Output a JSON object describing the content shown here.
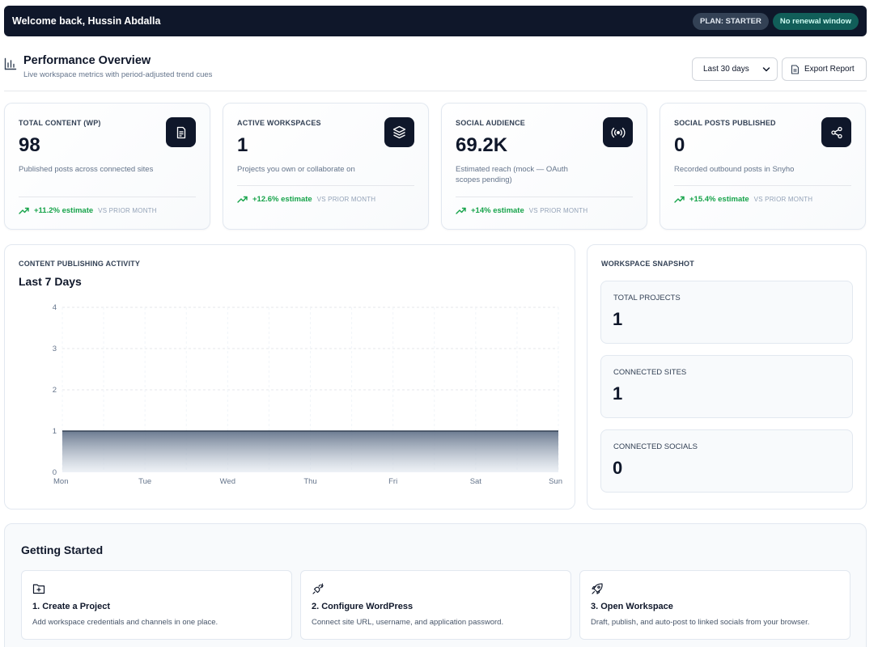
{
  "topbar": {
    "welcome": "Welcome back, Hussin Abdalla",
    "plan_badge": "PLAN: STARTER",
    "renewal_badge": "No renewal window"
  },
  "header": {
    "title": "Performance Overview",
    "subtitle": "Live workspace metrics with period-adjusted trend cues",
    "period_selected": "Last 30 days",
    "export_label": "Export Report"
  },
  "stats": [
    {
      "label": "TOTAL CONTENT (WP)",
      "value": "98",
      "desc": "Published posts across connected sites",
      "trend": "+11.2% estimate",
      "trend_note": "VS PRIOR MONTH",
      "icon": "document-icon"
    },
    {
      "label": "ACTIVE WORKSPACES",
      "value": "1",
      "desc": "Projects you own or collaborate on",
      "trend": "+12.6% estimate",
      "trend_note": "VS PRIOR MONTH",
      "icon": "layers-icon"
    },
    {
      "label": "SOCIAL AUDIENCE",
      "value": "69.2K",
      "desc": "Estimated reach (mock — OAuth scopes pending)",
      "trend": "+14% estimate",
      "trend_note": "VS PRIOR MONTH",
      "icon": "broadcast-icon"
    },
    {
      "label": "SOCIAL POSTS PUBLISHED",
      "value": "0",
      "desc": "Recorded outbound posts in Snyho",
      "trend": "+15.4% estimate",
      "trend_note": "VS PRIOR MONTH",
      "icon": "share-icon"
    }
  ],
  "chart": {
    "label": "CONTENT PUBLISHING ACTIVITY",
    "title": "Last 7 Days"
  },
  "chart_data": {
    "type": "area",
    "categories": [
      "Mon",
      "Tue",
      "Wed",
      "Thu",
      "Fri",
      "Sat",
      "Sun"
    ],
    "values": [
      1,
      1,
      1,
      1,
      1,
      1,
      1
    ],
    "yticks": [
      "0",
      "1",
      "2",
      "3",
      "4"
    ],
    "ylim": [
      0,
      4
    ],
    "grid": true,
    "legend": "none",
    "color": "#334155"
  },
  "snapshot": {
    "label": "WORKSPACE SNAPSHOT",
    "items": [
      {
        "label": "TOTAL PROJECTS",
        "value": "1"
      },
      {
        "label": "CONNECTED SITES",
        "value": "1"
      },
      {
        "label": "CONNECTED SOCIALS",
        "value": "0"
      }
    ]
  },
  "getting_started": {
    "title": "Getting Started",
    "steps": [
      {
        "title": "1. Create a Project",
        "desc": "Add workspace credentials and channels in one place.",
        "icon": "folder-plus-icon"
      },
      {
        "title": "2. Configure WordPress",
        "desc": "Connect site URL, username, and application password.",
        "icon": "plug-icon"
      },
      {
        "title": "3. Open Workspace",
        "desc": "Draft, publish, and auto-post to linked socials from your browser.",
        "icon": "rocket-icon"
      }
    ]
  },
  "colors": {
    "primary": "#0f172a",
    "trend_up": "#16a34a",
    "renewal_badge_bg": "#115e59"
  }
}
